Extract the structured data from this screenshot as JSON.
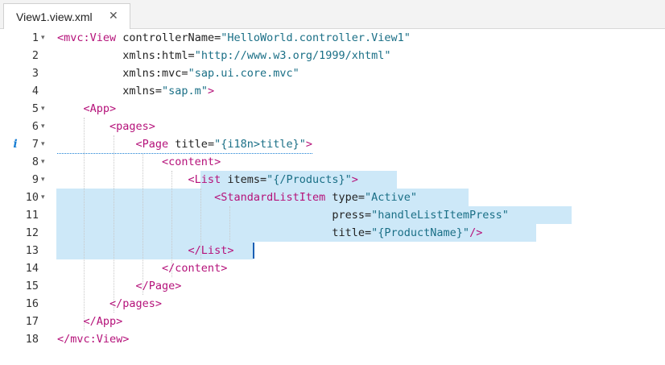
{
  "tab": {
    "title": "View1.view.xml",
    "close_glyph": "✕"
  },
  "info_marker": "i",
  "lines": [
    {
      "n": "1",
      "fold": "▾",
      "parts": [
        {
          "c": "tag",
          "t": "<mvc:View"
        },
        {
          "c": "attr",
          "t": " controllerName="
        },
        {
          "c": "str",
          "t": "\"HelloWorld.controller.View1\""
        }
      ]
    },
    {
      "n": "2",
      "fold": "",
      "parts": [
        {
          "c": "attr",
          "t": "          xmlns:html="
        },
        {
          "c": "str",
          "t": "\"http://www.w3.org/1999/xhtml\""
        }
      ]
    },
    {
      "n": "3",
      "fold": "",
      "parts": [
        {
          "c": "attr",
          "t": "          xmlns:mvc="
        },
        {
          "c": "str",
          "t": "\"sap.ui.core.mvc\""
        }
      ]
    },
    {
      "n": "4",
      "fold": "",
      "parts": [
        {
          "c": "attr",
          "t": "          xmlns="
        },
        {
          "c": "str",
          "t": "\"sap.m\""
        },
        {
          "c": "tag",
          "t": ">"
        }
      ]
    },
    {
      "n": "5",
      "fold": "▾",
      "parts": [
        {
          "c": "tag",
          "t": "    <App>"
        }
      ]
    },
    {
      "n": "6",
      "fold": "▾",
      "parts": [
        {
          "c": "tag",
          "t": "        <pages>"
        }
      ]
    },
    {
      "n": "7",
      "fold": "▾",
      "info": true,
      "parts": [
        {
          "c": "tag",
          "t": "            <Page"
        },
        {
          "c": "attr",
          "t": " title="
        },
        {
          "c": "str",
          "t": "\"{i18n>title}\""
        },
        {
          "c": "tag",
          "t": ">"
        }
      ]
    },
    {
      "n": "8",
      "fold": "▾",
      "parts": [
        {
          "c": "tag",
          "t": "                <content>"
        }
      ]
    },
    {
      "n": "9",
      "fold": "▾",
      "parts": [
        {
          "c": "tag",
          "t": "                    <List"
        },
        {
          "c": "attr",
          "t": " items="
        },
        {
          "c": "str",
          "t": "\"{/Products}\""
        },
        {
          "c": "tag",
          "t": ">"
        }
      ]
    },
    {
      "n": "10",
      "fold": "▾",
      "parts": [
        {
          "c": "tag",
          "t": "                        <StandardListItem"
        },
        {
          "c": "attr",
          "t": " type="
        },
        {
          "c": "str",
          "t": "\"Active\""
        }
      ]
    },
    {
      "n": "11",
      "fold": "",
      "parts": [
        {
          "c": "attr",
          "t": "                                          press="
        },
        {
          "c": "str",
          "t": "\"handleListItemPress\""
        }
      ]
    },
    {
      "n": "12",
      "fold": "",
      "parts": [
        {
          "c": "attr",
          "t": "                                          title="
        },
        {
          "c": "str",
          "t": "\"{ProductName}\""
        },
        {
          "c": "tag",
          "t": "/>"
        }
      ]
    },
    {
      "n": "13",
      "fold": "",
      "parts": [
        {
          "c": "tag",
          "t": "                    </List>"
        }
      ]
    },
    {
      "n": "14",
      "fold": "",
      "parts": [
        {
          "c": "tag",
          "t": "                </content>"
        }
      ]
    },
    {
      "n": "15",
      "fold": "",
      "parts": [
        {
          "c": "tag",
          "t": "            </Page>"
        }
      ]
    },
    {
      "n": "16",
      "fold": "",
      "parts": [
        {
          "c": "tag",
          "t": "        </pages>"
        }
      ]
    },
    {
      "n": "17",
      "fold": "",
      "parts": [
        {
          "c": "tag",
          "t": "    </App>"
        }
      ]
    },
    {
      "n": "18",
      "fold": "",
      "parts": [
        {
          "c": "tag",
          "t": "</mvc:View>"
        }
      ]
    }
  ]
}
